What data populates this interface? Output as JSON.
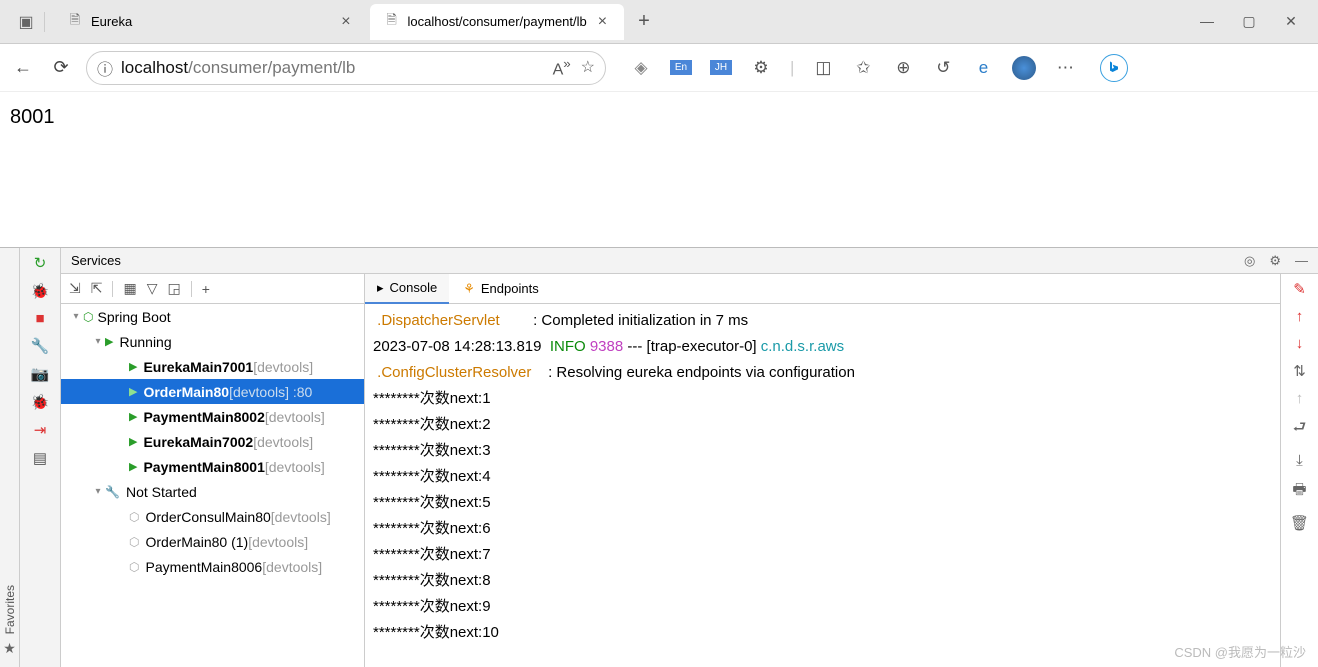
{
  "browser": {
    "tabs": [
      {
        "title": "Eureka"
      },
      {
        "title": "localhost/consumer/payment/lb"
      }
    ],
    "url_host": "localhost",
    "url_path": "/consumer/payment/lb"
  },
  "page_body": "8001",
  "ide": {
    "services_title": "Services",
    "favorites": "Favorites",
    "tree": {
      "root": "Spring Boot",
      "running": "Running",
      "not_started": "Not Started",
      "items": [
        {
          "name": "EurekaMain7001",
          "suffix": " [devtools]"
        },
        {
          "name": "OrderMain80",
          "suffix": " [devtools] :80"
        },
        {
          "name": "PaymentMain8002",
          "suffix": " [devtools]"
        },
        {
          "name": "EurekaMain7002",
          "suffix": " [devtools]"
        },
        {
          "name": "PaymentMain8001",
          "suffix": " [devtools]"
        }
      ],
      "stopped": [
        {
          "name": "OrderConsulMain80",
          "suffix": " [devtools]"
        },
        {
          "name": "OrderMain80 (1)",
          "suffix": " [devtools]"
        },
        {
          "name": "PaymentMain8006",
          "suffix": " [devtools]"
        }
      ]
    },
    "tabs": {
      "console": "Console",
      "endpoints": "Endpoints"
    },
    "console_lines": [
      {
        "t": "servlet",
        "a": ".DispatcherServlet",
        "colon": "        : ",
        "b": "Completed initialization in 7 ms"
      },
      {
        "t": "log",
        "ts": "2023-07-08 14:28:13.819  ",
        "lvl": "INFO ",
        "pid": "9388 ",
        "dash": "--- [trap-executor-0] ",
        "comp": "c.n.d.s.r.aws"
      },
      {
        "t": "servlet",
        "a": ".ConfigClusterResolver",
        "colon": "    : ",
        "b": "Resolving eureka endpoints via configuration"
      },
      {
        "t": "plain",
        "text": "********次数next:1"
      },
      {
        "t": "plain",
        "text": "********次数next:2"
      },
      {
        "t": "plain",
        "text": "********次数next:3"
      },
      {
        "t": "plain",
        "text": "********次数next:4"
      },
      {
        "t": "plain",
        "text": "********次数next:5"
      },
      {
        "t": "plain",
        "text": "********次数next:6"
      },
      {
        "t": "plain",
        "text": "********次数next:7"
      },
      {
        "t": "plain",
        "text": "********次数next:8"
      },
      {
        "t": "plain",
        "text": "********次数next:9"
      },
      {
        "t": "plain",
        "text": "********次数next:10"
      }
    ]
  },
  "watermark": "CSDN @我愿为一粒沙"
}
